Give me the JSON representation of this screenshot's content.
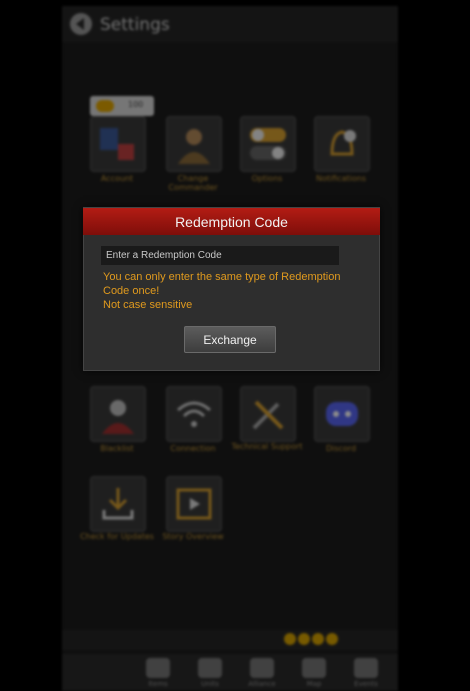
{
  "header": {
    "title": "Settings",
    "back_icon": "back-arrow-icon"
  },
  "resource_badge": {
    "icon": "gold-coin-icon",
    "value": "100"
  },
  "settings_tiles_row1": [
    {
      "label": "Account",
      "icon": "facebook-account-icon"
    },
    {
      "label": "Change Commander",
      "icon": "commander-portrait-icon"
    },
    {
      "label": "Options",
      "icon": "toggle-switch-icon"
    },
    {
      "label": "Notifications",
      "icon": "bell-icon"
    }
  ],
  "settings_tiles_row3": [
    {
      "label": "Blacklist",
      "icon": "blocked-user-icon"
    },
    {
      "label": "Connection",
      "icon": "wifi-icon"
    },
    {
      "label": "Technical Support",
      "icon": "tools-icon"
    },
    {
      "label": "Discord",
      "icon": "discord-icon"
    }
  ],
  "settings_tiles_row4": [
    {
      "label": "Check for Updates",
      "icon": "download-icon"
    },
    {
      "label": "Story Overview",
      "icon": "film-icon"
    }
  ],
  "bottom_nav": [
    {
      "label": "Hero"
    },
    {
      "label": "Items"
    },
    {
      "label": "Units"
    },
    {
      "label": "Alliance"
    },
    {
      "label": "Map"
    },
    {
      "label": "Events"
    }
  ],
  "modal": {
    "title": "Redemption Code",
    "input_placeholder": "Enter a Redemption Code",
    "input_value": "",
    "warning_line1": "You can only enter the same type of Redemption",
    "warning_line2": "Code once!",
    "warning_line3": "Not case sensitive",
    "button_label": "Exchange"
  },
  "colors": {
    "modal_header": "#b31c14",
    "warning_text": "#e09a1e",
    "modal_bg": "#2e2e2e"
  }
}
